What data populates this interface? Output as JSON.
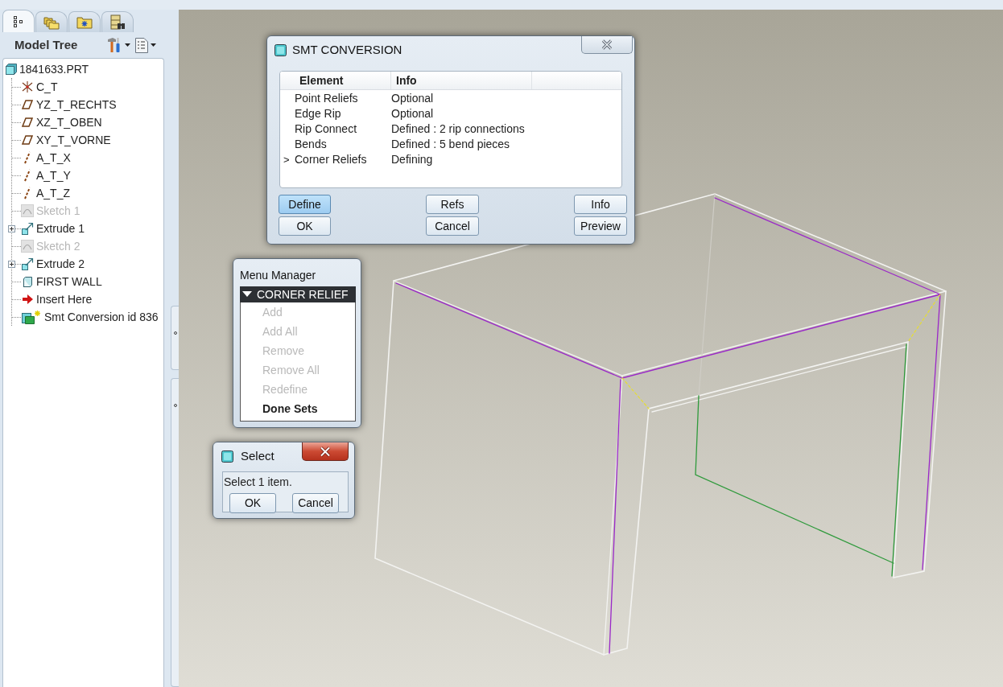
{
  "model_tree": {
    "tabs": [
      {
        "kind": "tree",
        "selected": true
      },
      {
        "kind": "layers",
        "selected": false
      },
      {
        "kind": "favorites",
        "selected": false
      },
      {
        "kind": "connections",
        "selected": false
      }
    ],
    "title": "Model Tree",
    "items": [
      {
        "label": "1841633.PRT",
        "kind": "part",
        "dimmed": false,
        "collapsed": false,
        "children": [
          {
            "label": "C_T",
            "kind": "csys",
            "dimmed": false,
            "collapsed": false
          },
          {
            "label": "YZ_T_RECHTS",
            "kind": "plane",
            "dimmed": false,
            "collapsed": false
          },
          {
            "label": "XZ_T_OBEN",
            "kind": "plane",
            "dimmed": false,
            "collapsed": false
          },
          {
            "label": "XY_T_VORNE",
            "kind": "plane",
            "dimmed": false,
            "collapsed": false
          },
          {
            "label": "A_T_X",
            "kind": "axis",
            "dimmed": false,
            "collapsed": false
          },
          {
            "label": "A_T_Y",
            "kind": "axis",
            "dimmed": false,
            "collapsed": false
          },
          {
            "label": "A_T_Z",
            "kind": "axis",
            "dimmed": false,
            "collapsed": false
          },
          {
            "label": "Sketch 1",
            "kind": "sketch",
            "dimmed": true,
            "collapsed": false
          },
          {
            "label": "Extrude 1",
            "kind": "extrude",
            "dimmed": false,
            "collapsed": true
          },
          {
            "label": "Sketch 2",
            "kind": "sketch",
            "dimmed": true,
            "collapsed": false
          },
          {
            "label": "Extrude 2",
            "kind": "extrude",
            "dimmed": false,
            "collapsed": true
          },
          {
            "label": "FIRST WALL",
            "kind": "wall",
            "dimmed": false,
            "collapsed": false
          },
          {
            "label": "Insert Here",
            "kind": "insert",
            "dimmed": false,
            "collapsed": false
          },
          {
            "label": "Smt Conversion id 836",
            "kind": "conversion",
            "dimmed": false,
            "collapsed": false
          }
        ]
      }
    ]
  },
  "smt_conversion": {
    "title": "SMT CONVERSION",
    "columns": [
      "Element",
      "Info"
    ],
    "rows": [
      {
        "element": "Point Reliefs",
        "info": "Optional"
      },
      {
        "element": "Edge Rip",
        "info": "Optional"
      },
      {
        "element": "Rip Connect",
        "info": "Defined : 2 rip connections"
      },
      {
        "element": "Bends",
        "info": "Defined : 5 bend pieces"
      },
      {
        "pointer": ">",
        "element": "Corner Reliefs",
        "info": "Defining"
      }
    ],
    "buttons": [
      {
        "label": "Define",
        "highlighted": true
      },
      {
        "label": "Refs",
        "highlighted": false
      },
      {
        "label": "Info",
        "highlighted": false
      },
      {
        "label": "OK",
        "highlighted": false
      },
      {
        "label": "Cancel",
        "highlighted": false
      },
      {
        "label": "Preview",
        "highlighted": false
      }
    ]
  },
  "menu_manager": {
    "title": "Menu Manager",
    "header": "CORNER RELIEF",
    "expanded": true,
    "items": [
      {
        "label": "Add",
        "disabled": true
      },
      {
        "label": "Add All",
        "disabled": true
      },
      {
        "label": "Remove",
        "disabled": true
      },
      {
        "label": "Remove All",
        "disabled": true
      },
      {
        "label": "Redefine",
        "disabled": true
      },
      {
        "label": "Done Sets",
        "disabled": false
      }
    ]
  },
  "select_dialog": {
    "title": "Select",
    "message": "Select 1 item.",
    "buttons": [
      "OK",
      "Cancel"
    ]
  }
}
